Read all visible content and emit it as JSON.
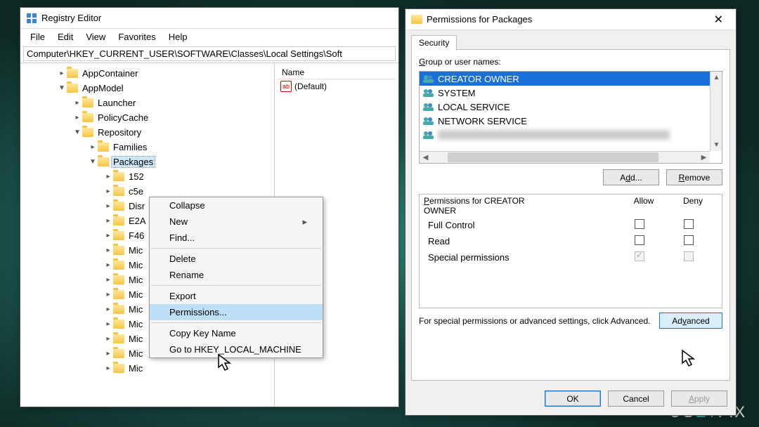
{
  "regedit": {
    "title": "Registry Editor",
    "menus": [
      "File",
      "Edit",
      "View",
      "Favorites",
      "Help"
    ],
    "address": "Computer\\HKEY_CURRENT_USER\\SOFTWARE\\Classes\\Local Settings\\Soft",
    "tree": [
      {
        "indent": 52,
        "chev": ">",
        "label": "AppContainer"
      },
      {
        "indent": 52,
        "chev": "v",
        "label": "AppModel"
      },
      {
        "indent": 74,
        "chev": ">",
        "label": "Launcher"
      },
      {
        "indent": 74,
        "chev": ">",
        "label": "PolicyCache"
      },
      {
        "indent": 74,
        "chev": "v",
        "label": "Repository"
      },
      {
        "indent": 96,
        "chev": ">",
        "label": "Families"
      },
      {
        "indent": 96,
        "chev": "v",
        "label": "Packages",
        "selected": true
      },
      {
        "indent": 118,
        "chev": ">",
        "label": "152"
      },
      {
        "indent": 118,
        "chev": ">",
        "label": "c5e"
      },
      {
        "indent": 118,
        "chev": ">",
        "label": "Disr"
      },
      {
        "indent": 118,
        "chev": ">",
        "label": "E2A"
      },
      {
        "indent": 118,
        "chev": ">",
        "label": "F46"
      },
      {
        "indent": 118,
        "chev": ">",
        "label": "Mic"
      },
      {
        "indent": 118,
        "chev": ">",
        "label": "Mic"
      },
      {
        "indent": 118,
        "chev": ">",
        "label": "Mic"
      },
      {
        "indent": 118,
        "chev": ">",
        "label": "Mic"
      },
      {
        "indent": 118,
        "chev": ">",
        "label": "Mic"
      },
      {
        "indent": 118,
        "chev": ">",
        "label": "Mic"
      },
      {
        "indent": 118,
        "chev": ">",
        "label": "Mic"
      },
      {
        "indent": 118,
        "chev": ">",
        "label": "Mic"
      },
      {
        "indent": 118,
        "chev": ">",
        "label": "Mic"
      }
    ],
    "list_header": "Name",
    "list_default": "(Default)"
  },
  "context_menu": {
    "items": [
      {
        "label": "Collapse"
      },
      {
        "label": "New",
        "arrow": true
      },
      {
        "label": "Find..."
      },
      {
        "sep": true
      },
      {
        "label": "Delete"
      },
      {
        "label": "Rename"
      },
      {
        "sep": true
      },
      {
        "label": "Export"
      },
      {
        "label": "Permissions...",
        "hl": true
      },
      {
        "sep": true
      },
      {
        "label": "Copy Key Name"
      },
      {
        "label": "Go to HKEY_LOCAL_MACHINE"
      }
    ]
  },
  "perm": {
    "title": "Permissions for Packages",
    "tab": "Security",
    "group_label": "Group or user names:",
    "users": [
      {
        "label": "CREATOR OWNER",
        "sel": true
      },
      {
        "label": "SYSTEM"
      },
      {
        "label": "LOCAL SERVICE"
      },
      {
        "label": "NETWORK SERVICE"
      },
      {
        "blur": true
      }
    ],
    "add": "Add...",
    "remove_pre": "",
    "remove": "Remove",
    "remove_u": "R",
    "remove_rest": "emove",
    "perm_label": "Permissions for CREATOR OWNER",
    "cols": {
      "allow": "Allow",
      "deny": "Deny"
    },
    "rows": [
      {
        "name": "Full Control",
        "allow": false,
        "deny": false,
        "dis": false
      },
      {
        "name": "Read",
        "allow": false,
        "deny": false,
        "dis": false
      },
      {
        "name": "Special permissions",
        "allow": true,
        "deny": false,
        "dis": true
      }
    ],
    "note": "For special permissions or advanced settings, click Advanced.",
    "advanced": "Advanced",
    "advanced_u": "v",
    "ok": "OK",
    "cancel": "Cancel",
    "apply": "Apply"
  },
  "watermark": {
    "pre": "UG",
    "mid": "ÉT",
    "post": "FIX"
  }
}
